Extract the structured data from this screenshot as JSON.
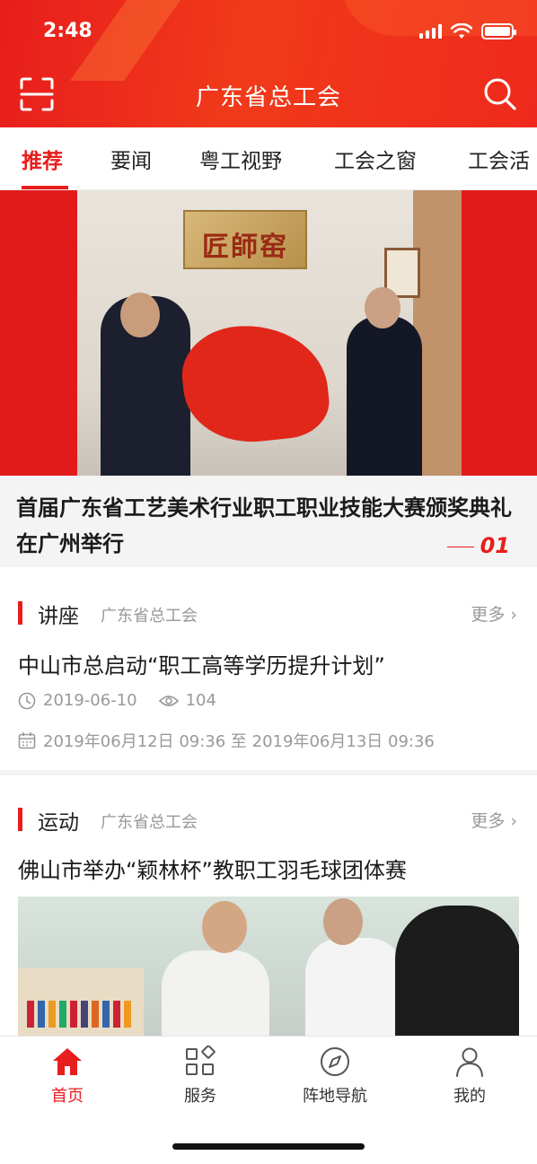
{
  "status_bar": {
    "time": "2:48"
  },
  "header": {
    "title": "广东省总工会",
    "scan_icon": "scan-icon",
    "search_icon": "search-icon"
  },
  "tabs": [
    {
      "label": "推荐",
      "active": true
    },
    {
      "label": "要闻"
    },
    {
      "label": "粤工视野"
    },
    {
      "label": "工会之窗"
    },
    {
      "label": "工会活"
    }
  ],
  "banner": {
    "plaque_text": "匠師窑",
    "caption": "首届广东省工艺美术行业职工职业技能大赛颁奖典礼在广州举行",
    "index": "01"
  },
  "sections": [
    {
      "title": "讲座",
      "source": "广东省总工会",
      "more": "更多",
      "article_title": "中山市总启动“职工高等学历提升计划”",
      "date": "2019-06-10",
      "views": "104",
      "schedule": "2019年06月12日 09:36 至 2019年06月13日 09:36"
    },
    {
      "title": "运动",
      "source": "广东省总工会",
      "more": "更多",
      "article_title": "佛山市举办“颖林杯”教职工羽毛球团体赛"
    }
  ],
  "bottom_nav": [
    {
      "label": "首页",
      "icon": "home-icon",
      "active": true
    },
    {
      "label": "服务",
      "icon": "grid-icon"
    },
    {
      "label": "阵地导航",
      "icon": "compass-icon"
    },
    {
      "label": "我的",
      "icon": "user-icon"
    }
  ],
  "colors": {
    "brand_red": "#e81d1d",
    "muted_text": "#999999"
  }
}
